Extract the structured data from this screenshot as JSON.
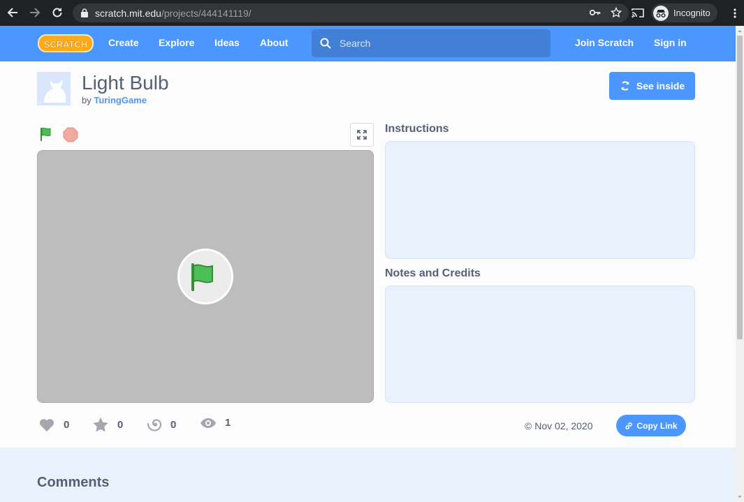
{
  "browser": {
    "url_host": "scratch.mit.edu",
    "url_path": "/projects/444141119/",
    "profile_label": "Incognito"
  },
  "nav": {
    "logo_text": "SCRATCH",
    "links": [
      "Create",
      "Explore",
      "Ideas",
      "About"
    ],
    "search_placeholder": "Search",
    "join": "Join Scratch",
    "signin": "Sign in",
    "brand_color": "#4c97ff"
  },
  "project": {
    "title": "Light Bulb",
    "by_prefix": "by",
    "author": "TuringGame",
    "see_inside": "See inside"
  },
  "sections": {
    "instructions": "Instructions",
    "notes": "Notes and Credits"
  },
  "stats": {
    "loves": "0",
    "favorites": "0",
    "remixes": "0",
    "views": "1"
  },
  "share_date": "© Nov 02, 2020",
  "copy_link": "Copy Link",
  "comments_title": "Comments"
}
